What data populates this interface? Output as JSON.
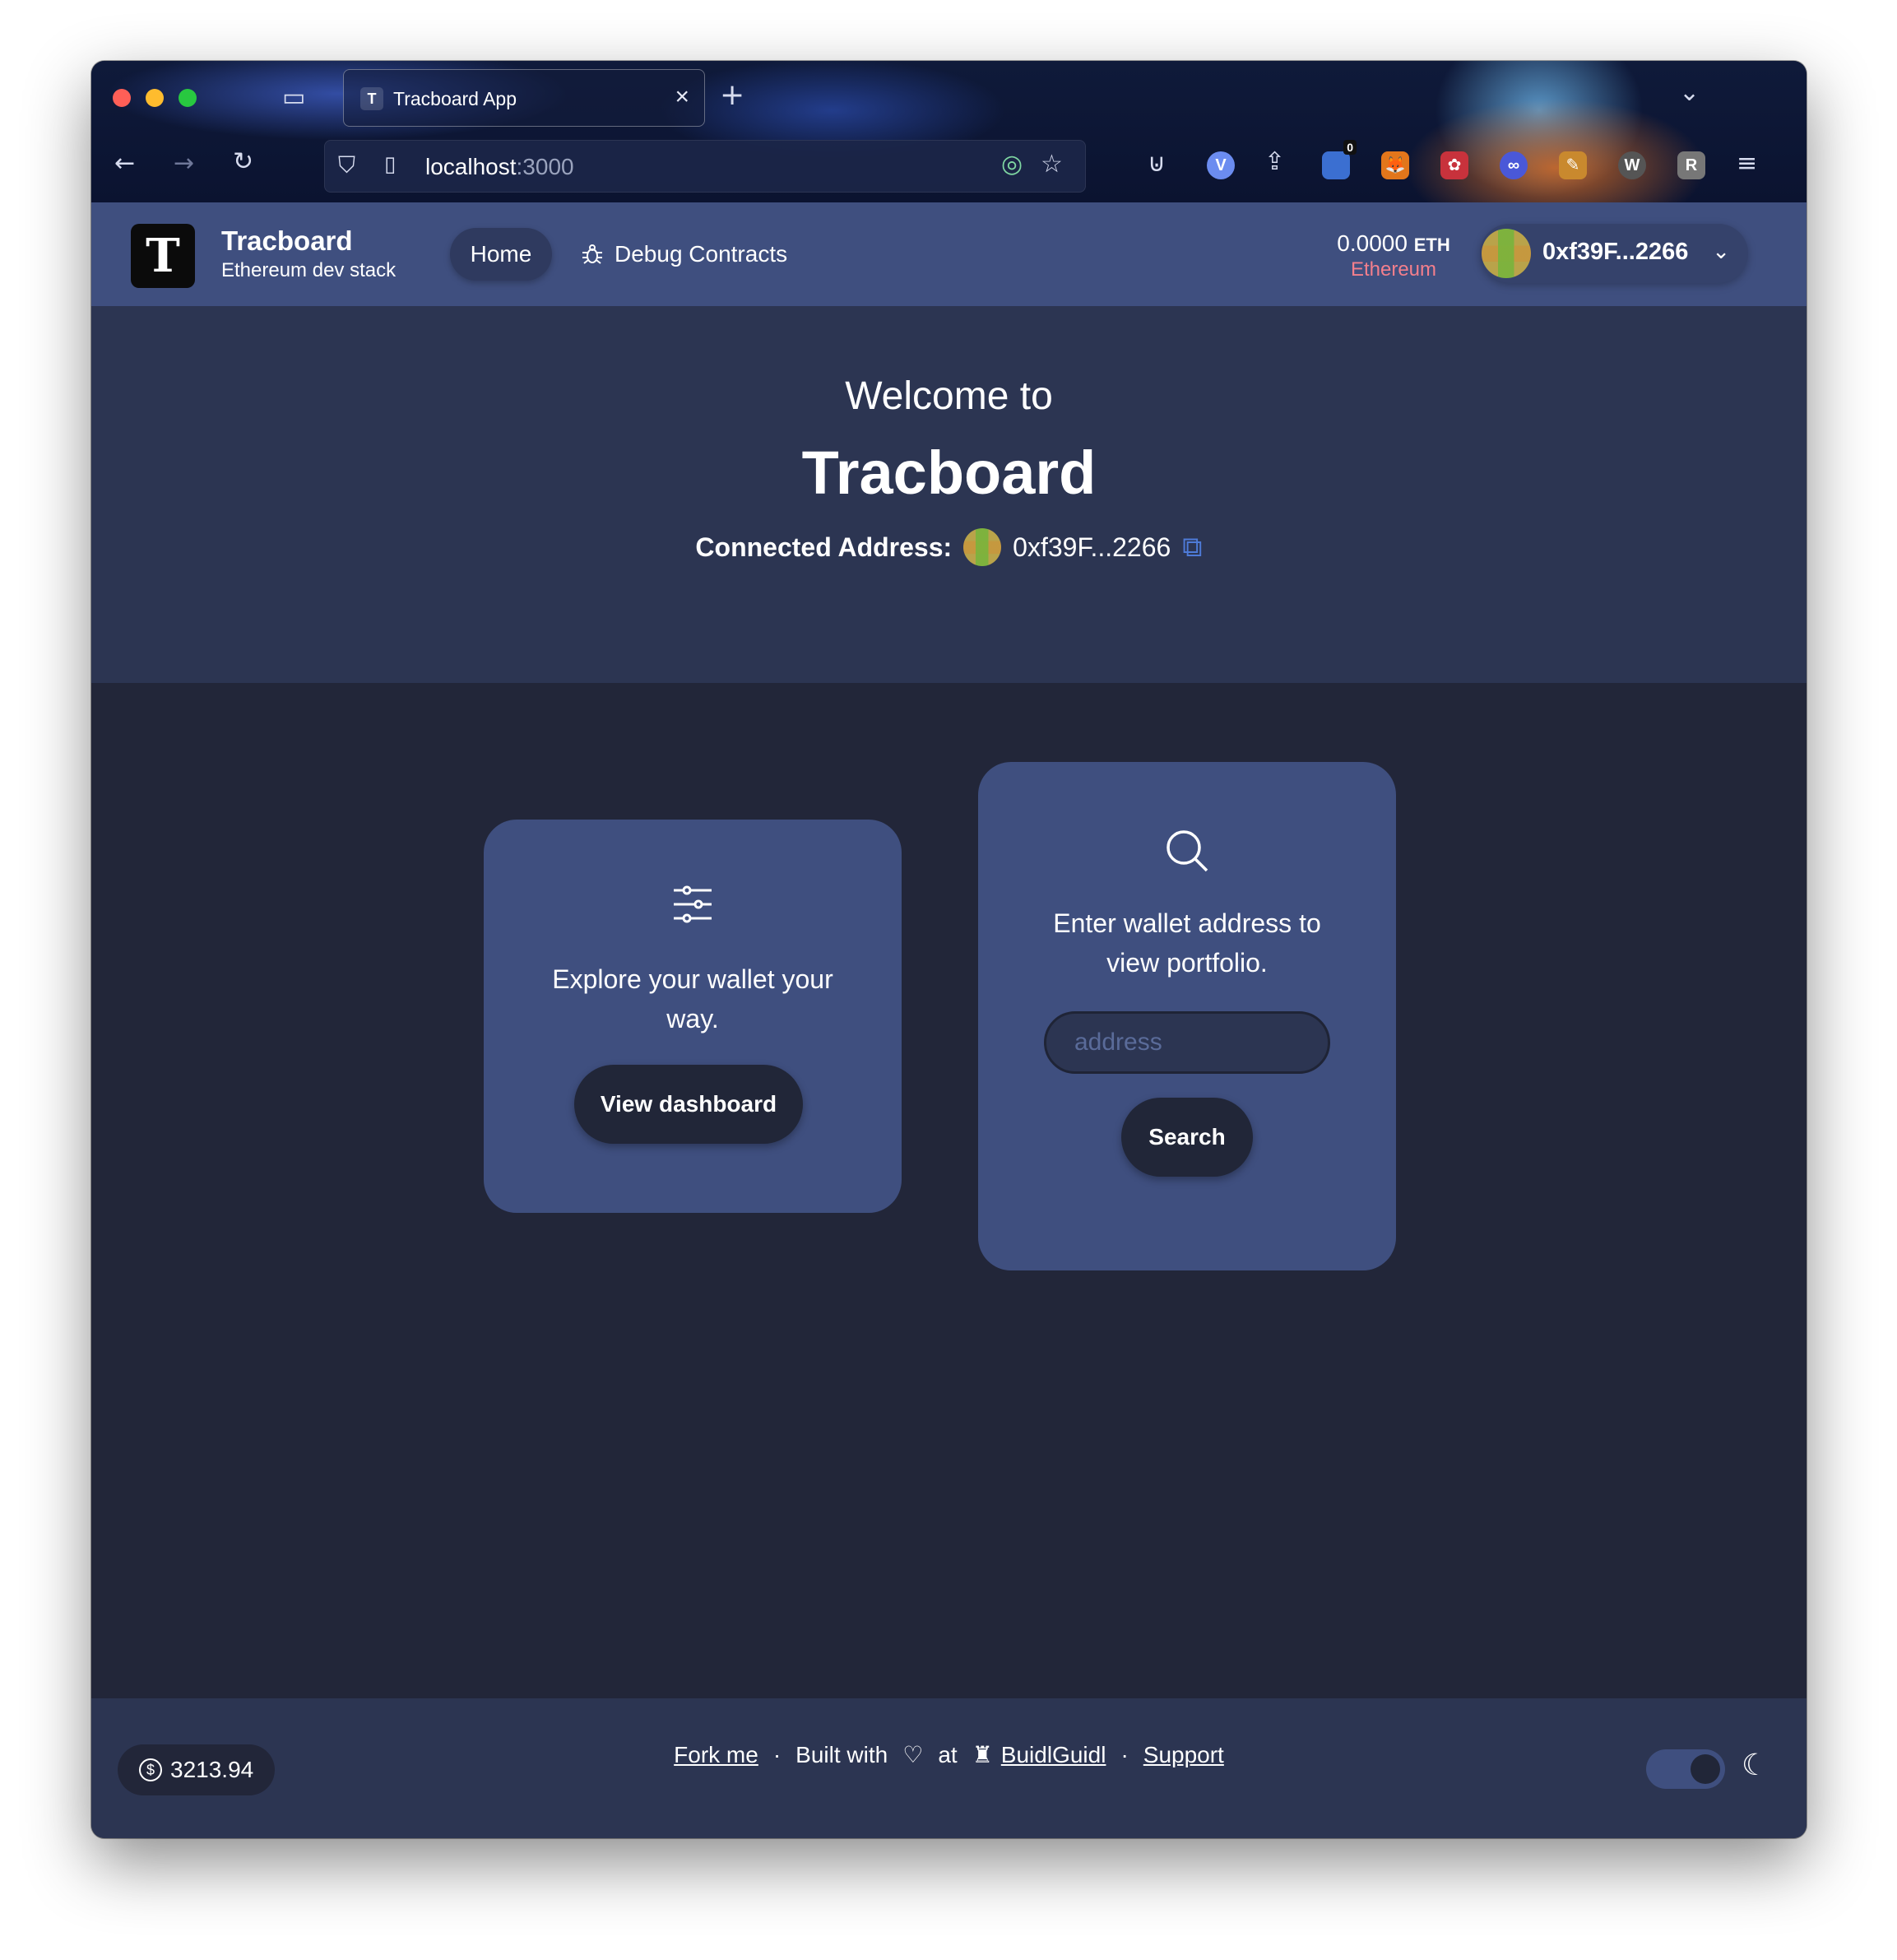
{
  "browser": {
    "tab_title": "Tracboard App",
    "url_host": "localhost",
    "url_port": ":3000",
    "extension_badge": "0"
  },
  "header": {
    "brand_title": "Tracboard",
    "brand_subtitle": "Ethereum dev stack",
    "nav": [
      {
        "label": "Home",
        "icon": "home"
      },
      {
        "label": "Debug Contracts",
        "icon": "bug-icon"
      }
    ],
    "balance_amount": "0.0000",
    "balance_unit": "ETH",
    "network": "Ethereum",
    "account_address": "0xf39F...2266"
  },
  "hero": {
    "welcome": "Welcome to",
    "title": "Tracboard",
    "connected_label": "Connected Address:",
    "connected_address": "0xf39F...2266"
  },
  "cards": {
    "dashboard": {
      "icon": "sliders-icon",
      "text": "Explore your wallet your way.",
      "button": "View dashboard"
    },
    "search": {
      "icon": "search-icon",
      "text": "Enter wallet address to view portfolio.",
      "input_placeholder": "address",
      "button": "Search"
    }
  },
  "footer": {
    "price": "3213.94",
    "fork_me": "Fork me",
    "built_with": "Built with",
    "at": "at",
    "buidlguidl": "BuidlGuidl",
    "support": "Support"
  },
  "colors": {
    "header_bg": "#3f4f7f",
    "hero_bg": "#2c3552",
    "page_bg": "#222639",
    "card_bg": "#3f4f7f",
    "button_bg": "#212638",
    "network_color": "#f47f8c"
  }
}
